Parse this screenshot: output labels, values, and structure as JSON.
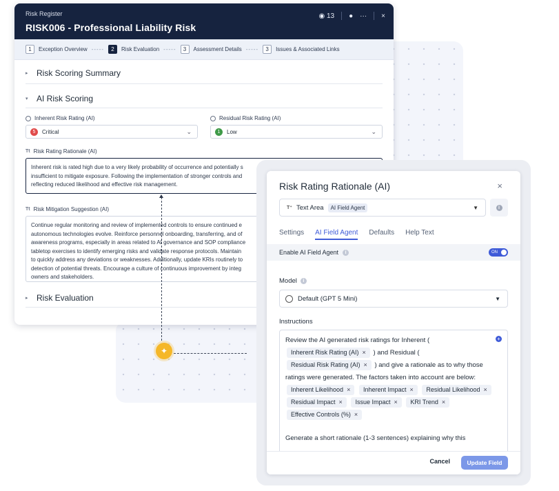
{
  "window": {
    "breadcrumb": "Risk Register",
    "title": "RISK006 - Professional Liability Risk",
    "notif_count": "13",
    "more": "···",
    "close": "×"
  },
  "steps": [
    {
      "num": "1",
      "label": "Exception Overview"
    },
    {
      "num": "2",
      "label": "Risk Evaluation"
    },
    {
      "num": "3",
      "label": "Assessment Details"
    },
    {
      "num": "3",
      "label": "Issues & Associated Links"
    }
  ],
  "sections": {
    "summary": "Risk Scoring Summary",
    "ai_scoring": "AI Risk Scoring",
    "risk_eval": "Risk Evaluation"
  },
  "inherent": {
    "label": "Inherent Risk Rating (AI)",
    "num": "5",
    "value": "Critical",
    "color": "#e04b4b"
  },
  "residual": {
    "label": "Residual Risk Rating (AI)",
    "num": "1",
    "value": "Low",
    "color": "#3f9a48"
  },
  "rationale": {
    "label": "Risk Rating Rationale (AI)",
    "lines": [
      "Inherent risk is rated high due to a very likely probability of occurrence and potentially s",
      "insufficient to mitigate exposure. Following the implementation of stronger controls and",
      "reflecting reduced likelihood and effective risk management."
    ]
  },
  "mitigation": {
    "label": "Risk Mitigation Suggestion (AI)",
    "lines": [
      "Continue regular monitoring and review of implemented controls to ensure continued e",
      "autonomous technologies evolve. Reinforce personnel onboarding, transferring, and of",
      "awareness programs, especially in areas related to AI governance and SOP compliance",
      "tabletop exercises to identify emerging risks and validate response protocols. Maintain",
      "to quickly address any deviations or weaknesses. Additionally, update KRIs routinely to",
      "detection of potential threats. Encourage a culture of continuous improvement by integ",
      "owners and stakeholders."
    ]
  },
  "panel": {
    "title": "Risk Rating Rationale (AI)",
    "close": "×",
    "field_type": "Text Area",
    "field_tag": "AI Field Agent",
    "tabs": [
      "Settings",
      "AI Field Agent",
      "Defaults",
      "Help Text"
    ],
    "enable_label": "Enable AI Field Agent",
    "toggle": "ON",
    "model_label": "Model",
    "model_value": "Default (GPT 5 Mini)",
    "instructions_label": "Instructions",
    "instr": {
      "t1": "Review the AI generated risk ratings for Inherent (",
      "chip1": "Inherent Risk Rating (AI)",
      "t2": ") and Residual (",
      "chip2": "Residual Risk Rating (AI)",
      "t3": ") and give a rationale as to why those ratings were generated. The factors taken into account are below:",
      "factors": [
        "Inherent Likelihood",
        "Inherent Impact",
        "Residual Likelihood",
        "Residual Impact",
        "Issue Impact",
        "KRI Trend",
        "Effective Controls (%)"
      ],
      "t4": "Generate a short rationale (1-3 sentences) explaining why this"
    },
    "cancel": "Cancel",
    "update": "Update Field"
  }
}
